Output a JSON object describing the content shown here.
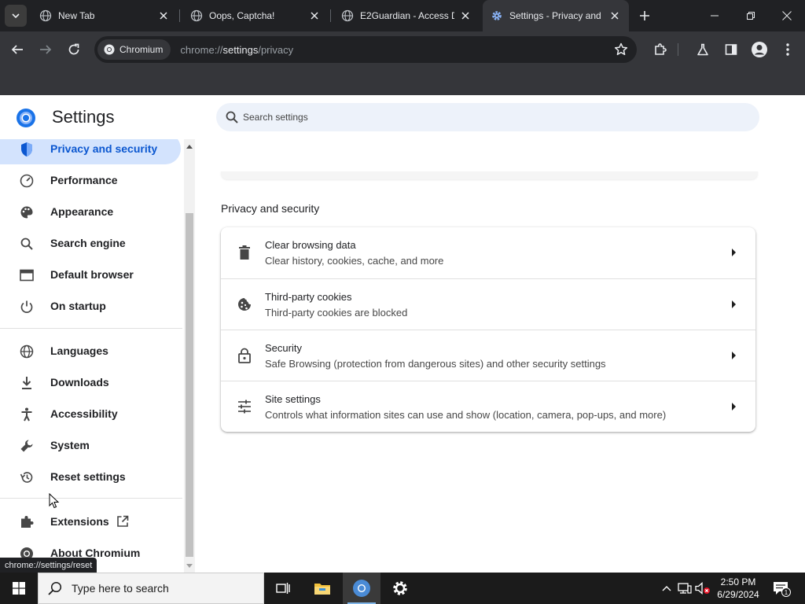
{
  "browser": {
    "tabs": [
      {
        "title": "New Tab",
        "active": false
      },
      {
        "title": "Oops, Captcha!",
        "active": false
      },
      {
        "title": "E2Guardian - Access D",
        "active": false
      },
      {
        "title": "Settings - Privacy and",
        "active": true
      }
    ],
    "omnibox": {
      "site_chip": "Chromium",
      "url_scheme": "chrome://",
      "url_host": "settings",
      "url_path": "/privacy"
    }
  },
  "settings": {
    "title": "Settings",
    "search_placeholder": "Search settings",
    "nav": [
      {
        "label": "Privacy and security",
        "icon": "shield-icon",
        "active": true
      },
      {
        "label": "Performance",
        "icon": "speedometer-icon"
      },
      {
        "label": "Appearance",
        "icon": "palette-icon"
      },
      {
        "label": "Search engine",
        "icon": "search-icon"
      },
      {
        "label": "Default browser",
        "icon": "browser-window-icon"
      },
      {
        "label": "On startup",
        "icon": "power-icon"
      },
      {
        "label": "Languages",
        "icon": "globe-icon"
      },
      {
        "label": "Downloads",
        "icon": "download-icon"
      },
      {
        "label": "Accessibility",
        "icon": "accessibility-icon"
      },
      {
        "label": "System",
        "icon": "wrench-icon"
      },
      {
        "label": "Reset settings",
        "icon": "history-icon"
      },
      {
        "label": "Extensions",
        "icon": "puzzle-icon"
      },
      {
        "label": "About Chromium",
        "icon": "chromium-icon"
      }
    ],
    "section_title": "Privacy and security",
    "rows": [
      {
        "title": "Clear browsing data",
        "subtitle": "Clear history, cookies, cache, and more",
        "icon": "trash-icon"
      },
      {
        "title": "Third-party cookies",
        "subtitle": "Third-party cookies are blocked",
        "icon": "cookie-icon"
      },
      {
        "title": "Security",
        "subtitle": "Safe Browsing (protection from dangerous sites) and other security settings",
        "icon": "lock-icon"
      },
      {
        "title": "Site settings",
        "subtitle": "Controls what information sites can use and show (location, camera, pop-ups, and more)",
        "icon": "sliders-icon"
      }
    ]
  },
  "status_bubble": "chrome://settings/reset",
  "taskbar": {
    "search_placeholder": "Type here to search",
    "time": "2:50 PM",
    "date": "6/29/2024",
    "notification_count": "1"
  },
  "colors": {
    "accent": "#0b57d0",
    "active_nav_bg": "#d3e3fd",
    "browser_dark": "#202124",
    "toolbar": "#35363a"
  }
}
